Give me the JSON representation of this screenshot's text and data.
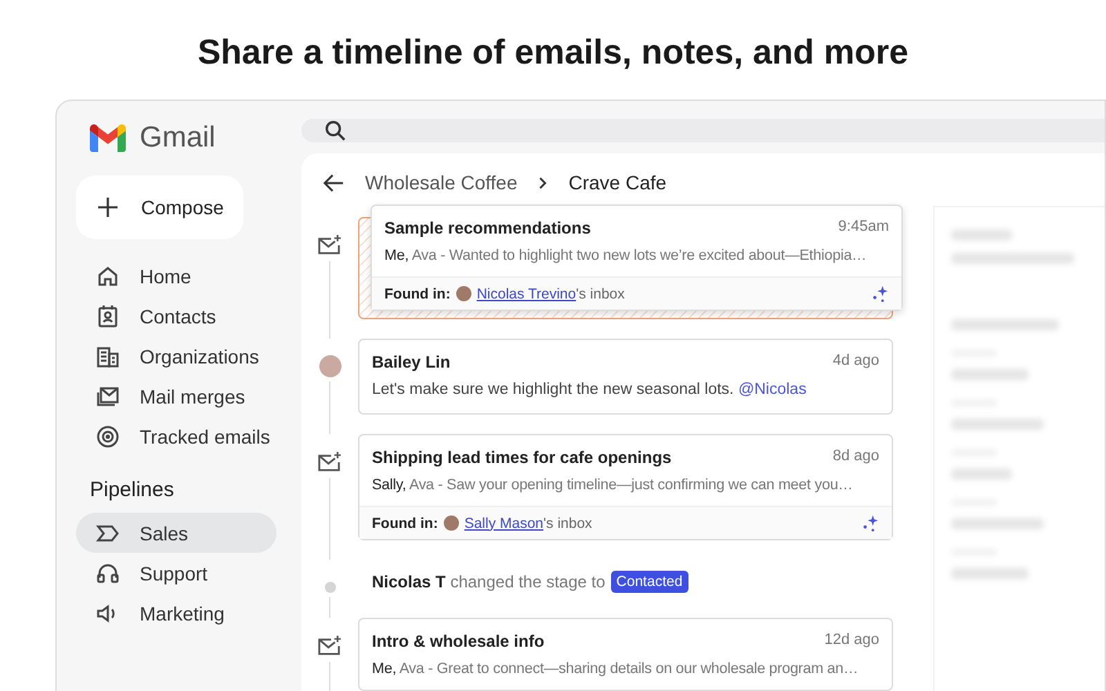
{
  "headline": "Share a timeline of emails, notes, and more",
  "app": {
    "name": "Gmail"
  },
  "compose": {
    "label": "Compose"
  },
  "nav": [
    {
      "label": "Home",
      "selected": false
    },
    {
      "label": "Contacts",
      "selected": false
    },
    {
      "label": "Organizations",
      "selected": false
    },
    {
      "label": "Mail merges",
      "selected": false
    },
    {
      "label": "Tracked emails",
      "selected": false
    }
  ],
  "pipelines": {
    "title": "Pipelines",
    "items": [
      {
        "label": "Sales",
        "selected": true
      },
      {
        "label": "Support",
        "selected": false
      },
      {
        "label": "Marketing",
        "selected": false
      }
    ]
  },
  "breadcrumb": [
    "Wholesale Coffee",
    "Crave Cafe"
  ],
  "timeline": [
    {
      "kind": "email",
      "highlighted": true,
      "subject": "Sample recommendations",
      "time": "9:45am",
      "from_main": "Me,",
      "from_rest": "Ava",
      "snippet": "- Wanted to highlight two new lots we’re excited about—Ethiopia…",
      "found_label": "Found in:",
      "found_person": "Nicolas Trevino",
      "found_suffix": "'s inbox"
    },
    {
      "kind": "note",
      "author": "Bailey Lin",
      "time": "4d ago",
      "text": "Let's make sure we highlight the new seasonal lots.",
      "mention": "@Nicolas"
    },
    {
      "kind": "email",
      "highlighted": false,
      "subject": "Shipping lead times for cafe openings",
      "time": "8d ago",
      "from_main": "Sally,",
      "from_rest": "Ava",
      "snippet": "- Saw your opening timeline—just confirming we can meet you…",
      "found_label": "Found in:",
      "found_person": "Sally Mason",
      "found_suffix": "'s inbox"
    },
    {
      "kind": "event",
      "author": "Nicolas T",
      "text": "changed the stage to",
      "badge": "Contacted"
    },
    {
      "kind": "email",
      "highlighted": false,
      "subject": "Intro & wholesale info",
      "time": "12d ago",
      "from_main": "Me,",
      "from_rest": "Ava",
      "snippet": "- Great to connect—sharing details on our wholesale program an…"
    }
  ]
}
